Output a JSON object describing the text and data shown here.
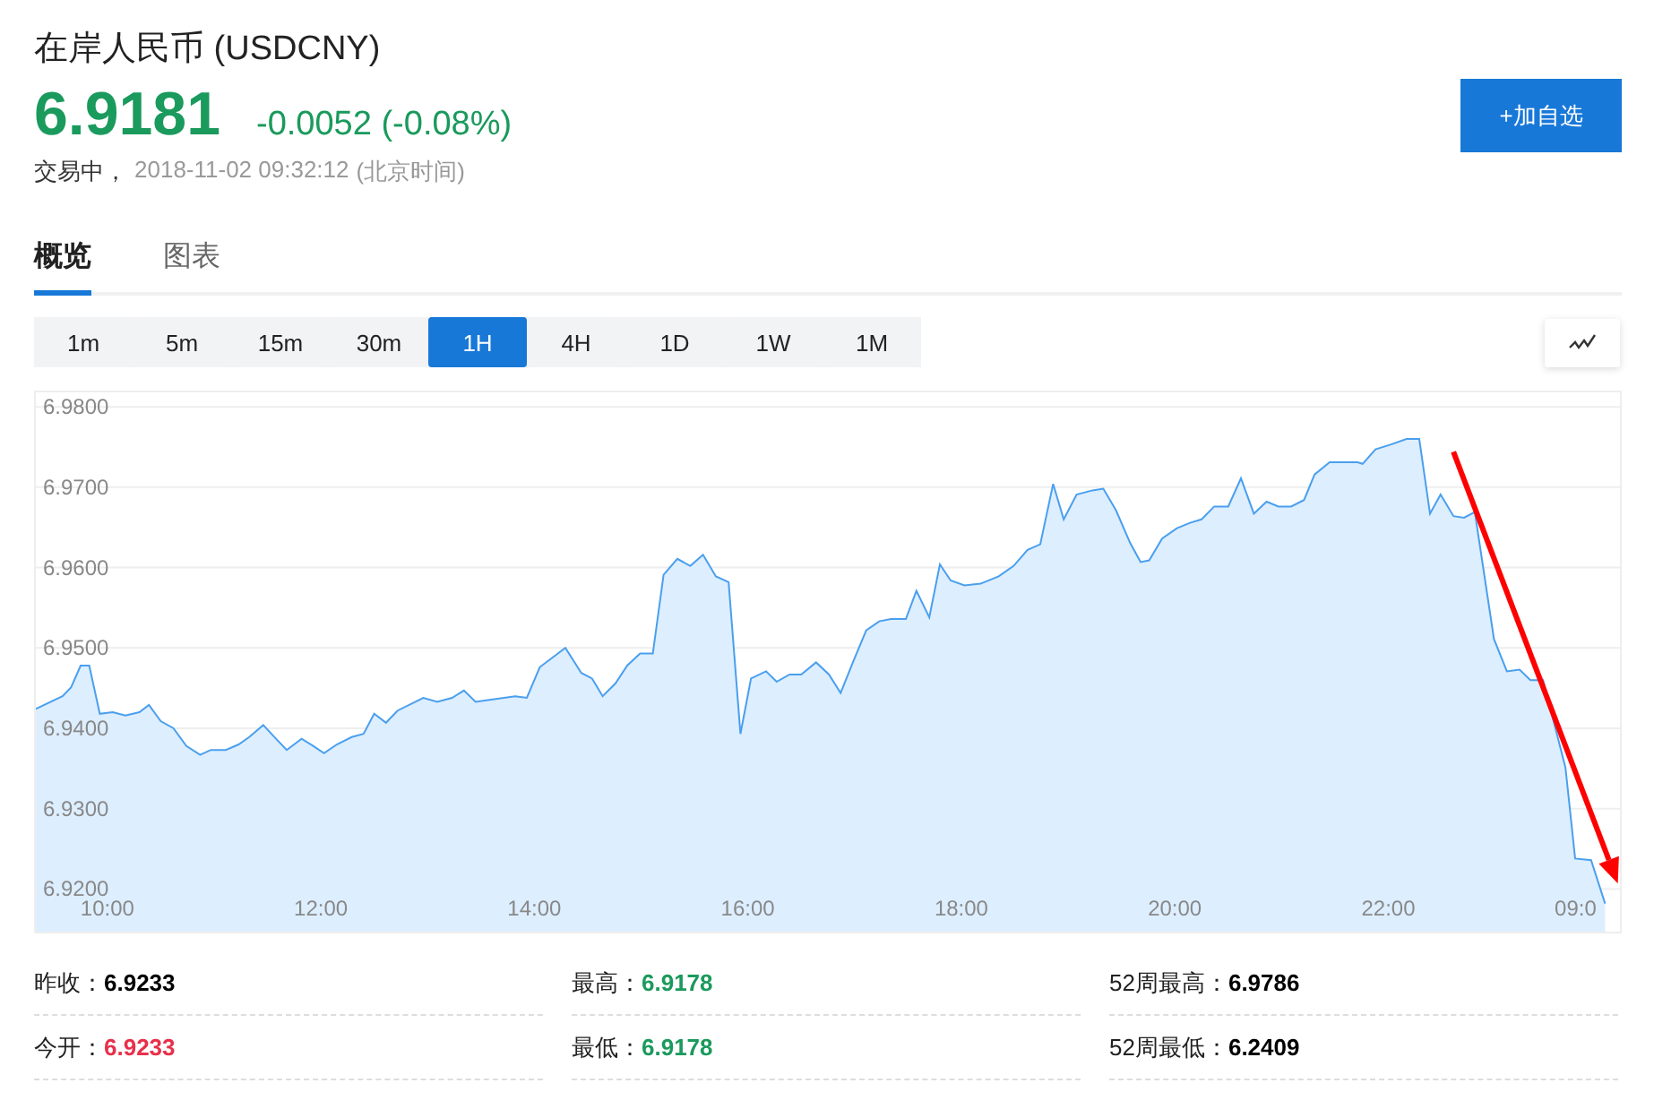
{
  "header": {
    "title": "在岸人民币 (USDCNY)",
    "price": "6.9181",
    "change": "-0.0052 (-0.08%)",
    "status": "交易中，",
    "time": "2018-11-02 09:32:12",
    "timezone": "(北京时间)",
    "button": "+加自选"
  },
  "tabs": [
    {
      "label": "概览",
      "selected": true
    },
    {
      "label": "图表",
      "selected": false
    }
  ],
  "periods": [
    {
      "label": "1m",
      "selected": false
    },
    {
      "label": "5m",
      "selected": false
    },
    {
      "label": "15m",
      "selected": false
    },
    {
      "label": "30m",
      "selected": false
    },
    {
      "label": "1H",
      "selected": true
    },
    {
      "label": "4H",
      "selected": false
    },
    {
      "label": "1D",
      "selected": false
    },
    {
      "label": "1W",
      "selected": false
    },
    {
      "label": "1M",
      "selected": false
    }
  ],
  "chart": {
    "chart_data": {
      "type": "area",
      "xlim": [
        9.33,
        24.17
      ],
      "ylim": [
        6.9147,
        6.9818
      ],
      "yticks": [
        {
          "value": 6.98,
          "label": "6.9800"
        },
        {
          "value": 6.97,
          "label": "6.9700"
        },
        {
          "value": 6.96,
          "label": "6.9600"
        },
        {
          "value": 6.95,
          "label": "6.9500"
        },
        {
          "value": 6.94,
          "label": "6.9400"
        },
        {
          "value": 6.93,
          "label": "6.9300"
        },
        {
          "value": 6.92,
          "label": "6.9200"
        }
      ],
      "xticks": [
        {
          "value": 10,
          "label": "10:00"
        },
        {
          "value": 12,
          "label": "12:00"
        },
        {
          "value": 14,
          "label": "14:00"
        },
        {
          "value": 16,
          "label": "16:00"
        },
        {
          "value": 18,
          "label": "18:00"
        },
        {
          "value": 20,
          "label": "20:00"
        },
        {
          "value": 22,
          "label": "22:00"
        },
        {
          "value": 23.95,
          "label": "09:0"
        }
      ],
      "x": [
        9.33,
        9.58,
        9.66,
        9.75,
        9.83,
        9.93,
        10.05,
        10.17,
        10.3,
        10.39,
        10.5,
        10.62,
        10.74,
        10.87,
        10.97,
        11.11,
        11.23,
        11.33,
        11.46,
        11.58,
        11.68,
        11.82,
        11.93,
        12.03,
        12.15,
        12.29,
        12.4,
        12.5,
        12.61,
        12.72,
        12.96,
        13.09,
        13.23,
        13.34,
        13.45,
        13.61,
        13.82,
        13.93,
        14.05,
        14.29,
        14.44,
        14.54,
        14.64,
        14.76,
        14.87,
        14.99,
        15.11,
        15.21,
        15.34,
        15.46,
        15.58,
        15.7,
        15.82,
        15.93,
        16.03,
        16.17,
        16.27,
        16.39,
        16.5,
        16.64,
        16.76,
        16.87,
        16.99,
        17.11,
        17.23,
        17.34,
        17.48,
        17.58,
        17.7,
        17.8,
        17.9,
        18.03,
        18.18,
        18.35,
        18.49,
        18.62,
        18.74,
        18.86,
        18.96,
        19.08,
        19.23,
        19.33,
        19.45,
        19.58,
        19.68,
        19.76,
        19.88,
        20.02,
        20.15,
        20.25,
        20.37,
        20.5,
        20.62,
        20.74,
        20.86,
        20.97,
        21.09,
        21.21,
        21.31,
        21.45,
        21.71,
        21.76,
        21.88,
        22.02,
        22.17,
        22.29,
        22.39,
        22.49,
        22.61,
        22.71,
        22.81,
        22.99,
        23.11,
        23.23,
        23.33,
        23.45,
        23.66,
        23.75,
        23.9,
        24.03
      ],
      "series": [
        {
          "color": "#4a9fee",
          "values": [
            6.9424,
            6.944,
            6.9451,
            6.9478,
            6.9478,
            6.9418,
            6.942,
            6.9416,
            6.942,
            6.9429,
            6.9409,
            6.94,
            6.9378,
            6.9367,
            6.9373,
            6.9373,
            6.938,
            6.9389,
            6.9404,
            6.9387,
            6.9373,
            6.9387,
            6.9378,
            6.9369,
            6.938,
            6.9389,
            6.9393,
            6.9418,
            6.9407,
            6.9422,
            6.9438,
            6.9433,
            6.9438,
            6.9447,
            6.9433,
            6.9436,
            6.944,
            6.9438,
            6.9476,
            6.95,
            6.9469,
            6.9462,
            6.944,
            6.9456,
            6.9478,
            6.9493,
            6.9493,
            6.9591,
            6.9611,
            6.9602,
            6.9616,
            6.9589,
            6.9582,
            6.9393,
            6.9462,
            6.9471,
            6.9458,
            6.9467,
            6.9467,
            6.9482,
            6.9467,
            6.9444,
            6.9484,
            6.9522,
            6.9533,
            6.9536,
            6.9536,
            6.9571,
            6.9538,
            6.9604,
            6.9584,
            6.9578,
            6.958,
            6.9589,
            6.9602,
            6.9622,
            6.9629,
            6.9704,
            6.966,
            6.9691,
            6.9696,
            6.9698,
            6.9671,
            6.9631,
            6.9607,
            6.9609,
            6.9636,
            6.9649,
            6.9656,
            6.966,
            6.9676,
            6.9676,
            6.9711,
            6.9667,
            6.9682,
            6.9676,
            6.9676,
            6.9684,
            6.9716,
            6.9731,
            6.9731,
            6.9729,
            6.9747,
            6.9753,
            6.976,
            6.976,
            6.9667,
            6.9691,
            6.9664,
            6.9662,
            6.9669,
            6.9511,
            6.9471,
            6.9473,
            6.946,
            6.946,
            6.9351,
            6.9238,
            6.9236,
            6.9182
          ]
        }
      ],
      "grid": true
    },
    "arrow": {
      "color": "#ff0000"
    }
  },
  "stats": [
    {
      "label": "昨收：",
      "value": "6.9233",
      "color": "#000000"
    },
    {
      "label": "最高：",
      "value": "6.9178",
      "color": "#1a9a5c"
    },
    {
      "label": "52周最高：",
      "value": "6.9786",
      "color": "#000000"
    },
    {
      "label": "今开：",
      "value": "6.9233",
      "color": "#e8304a"
    },
    {
      "label": "最低：",
      "value": "6.9178",
      "color": "#1a9a5c"
    },
    {
      "label": "52周最低：",
      "value": "6.2409",
      "color": "#000000"
    }
  ]
}
